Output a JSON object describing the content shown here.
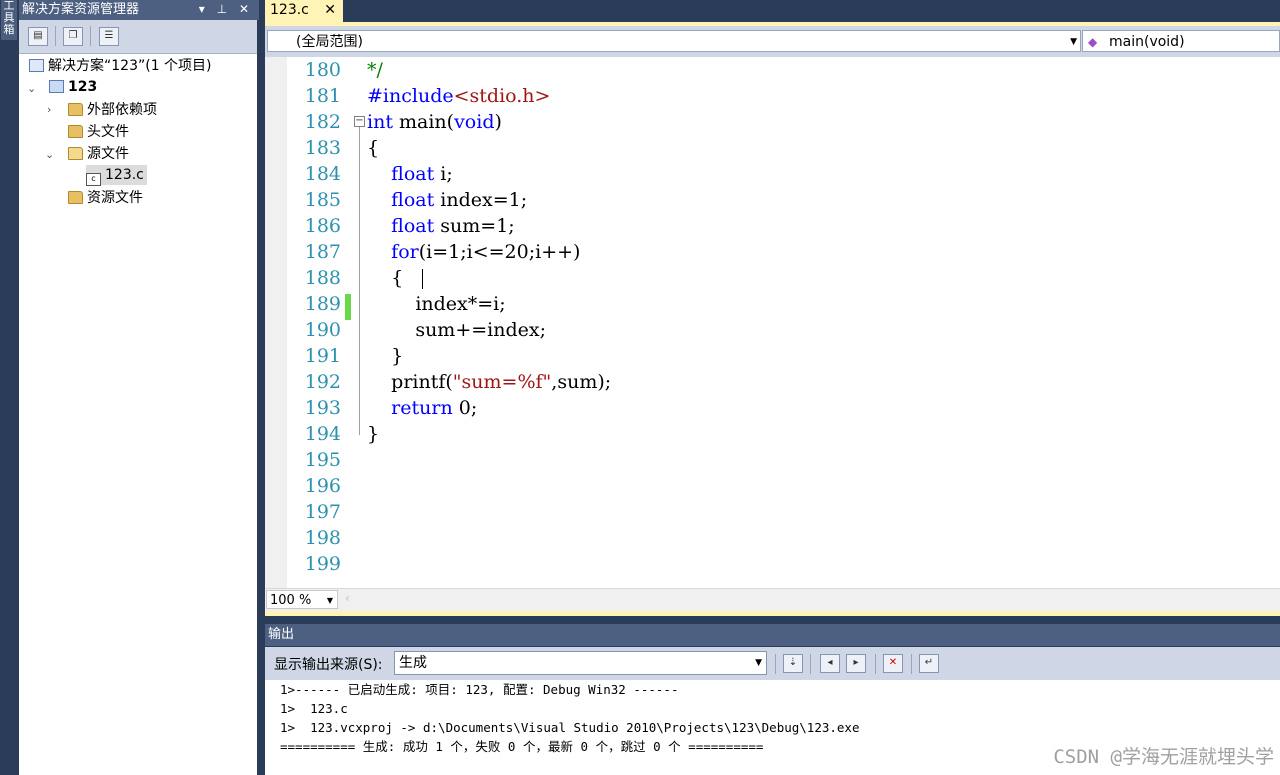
{
  "left_strip": {
    "label": "工具箱"
  },
  "solution_explorer": {
    "title": "解决方案资源管理器",
    "title_buttons": [
      "▾",
      "⊥",
      "✕"
    ],
    "tree": {
      "solution": "解决方案“123”(1 个项目)",
      "project": "123",
      "items": [
        "外部依赖项",
        "头文件",
        "源文件",
        "123.c",
        "资源文件"
      ]
    }
  },
  "editor": {
    "tab": {
      "label": "123.c",
      "close": "✕"
    },
    "nav": {
      "scope": "(全局范围)",
      "function": "main(void)"
    },
    "line_numbers": [
      "180",
      "181",
      "182",
      "183",
      "184",
      "185",
      "186",
      "187",
      "188",
      "189",
      "190",
      "191",
      "192",
      "193",
      "194",
      "195",
      "196",
      "197",
      "198",
      "199"
    ],
    "zoom": "100 %"
  },
  "output": {
    "title": "输出",
    "source_label": "显示输出来源(S):",
    "source_value": "生成",
    "lines": [
      "1>------ 已启动生成: 项目: 123, 配置: Debug Win32 ------",
      "1>  123.c",
      "1>  123.vcxproj -> d:\\Documents\\Visual Studio 2010\\Projects\\123\\Debug\\123.exe",
      "========== 生成: 成功 1 个，失败 0 个，最新 0 个，跳过 0 个 =========="
    ]
  },
  "watermark": "CSDN @学海无涯就埋头学",
  "colors": {
    "tab_active": "#fff3b5",
    "chrome_dark": "#2b3c59",
    "chrome_light": "#cfd6e5",
    "keyword": "#0000ff",
    "string": "#a31515",
    "comment": "#008000",
    "line_number": "#2b91af"
  }
}
